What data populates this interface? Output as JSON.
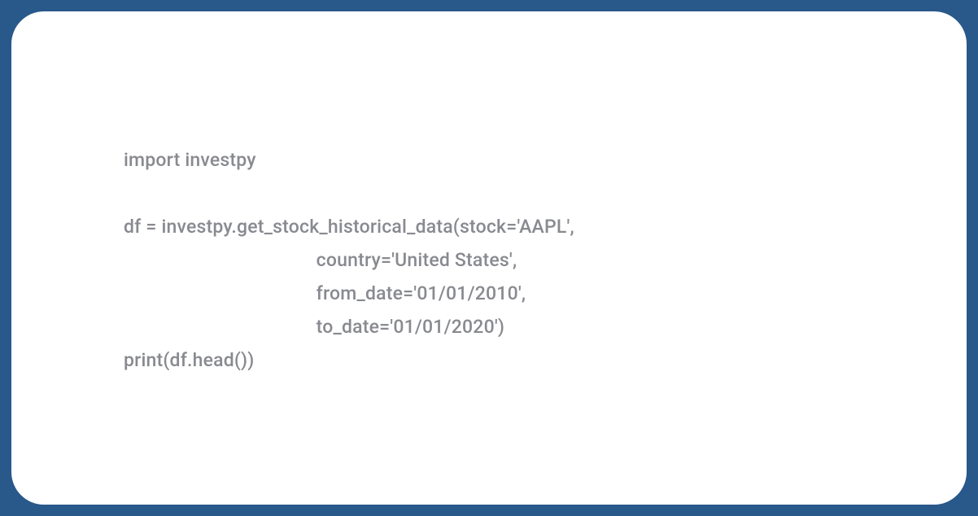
{
  "code": {
    "line1": "import investpy",
    "line2": "",
    "line3": "df = investpy.get_stock_historical_data(stock='AAPL',",
    "line4": "                                        country='United States',",
    "line5": "                                        from_date='01/01/2010',",
    "line6": "                                        to_date='01/01/2020')",
    "line7": "print(df.head())"
  }
}
